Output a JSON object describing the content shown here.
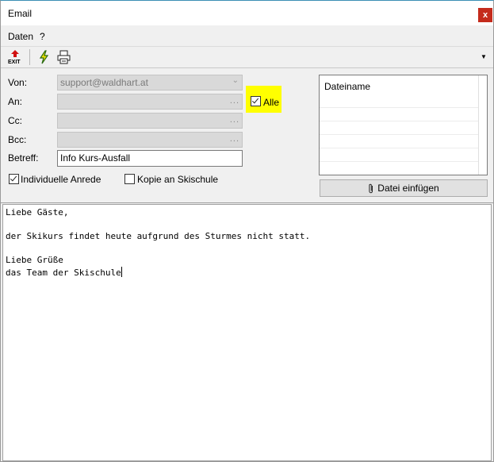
{
  "window": {
    "title": "Email",
    "close_label": "x"
  },
  "menu": {
    "items": [
      "Daten",
      "?"
    ]
  },
  "toolbar": {
    "exit_label": "EXIT"
  },
  "form": {
    "von": {
      "label": "Von:",
      "value": "support@waldhart.at"
    },
    "an": {
      "label": "An:",
      "value": "",
      "more": "..."
    },
    "cc": {
      "label": "Cc:",
      "value": "",
      "more": "..."
    },
    "bcc": {
      "label": "Bcc:",
      "value": "",
      "more": "..."
    },
    "betreff": {
      "label": "Betreff:",
      "value": "Info Kurs-Ausfall"
    },
    "alle": {
      "label": "Alle",
      "checked": true
    },
    "individuelle_anrede": {
      "label": "Individuelle Anrede",
      "checked": true
    },
    "kopie_skischule": {
      "label": "Kopie an Skischule",
      "checked": false
    }
  },
  "attachments": {
    "column_header": "Dateiname",
    "add_button": "Datei einfügen"
  },
  "message": {
    "lines": [
      "Liebe Gäste,",
      "",
      "der Skikurs findet heute aufgrund des Sturmes nicht statt.",
      "",
      "Liebe Grüße",
      "das Team der Skischule"
    ]
  },
  "colors": {
    "highlight": "#ffff00",
    "close": "#c42b1c",
    "titlebar_accent": "#3c8fb5"
  }
}
